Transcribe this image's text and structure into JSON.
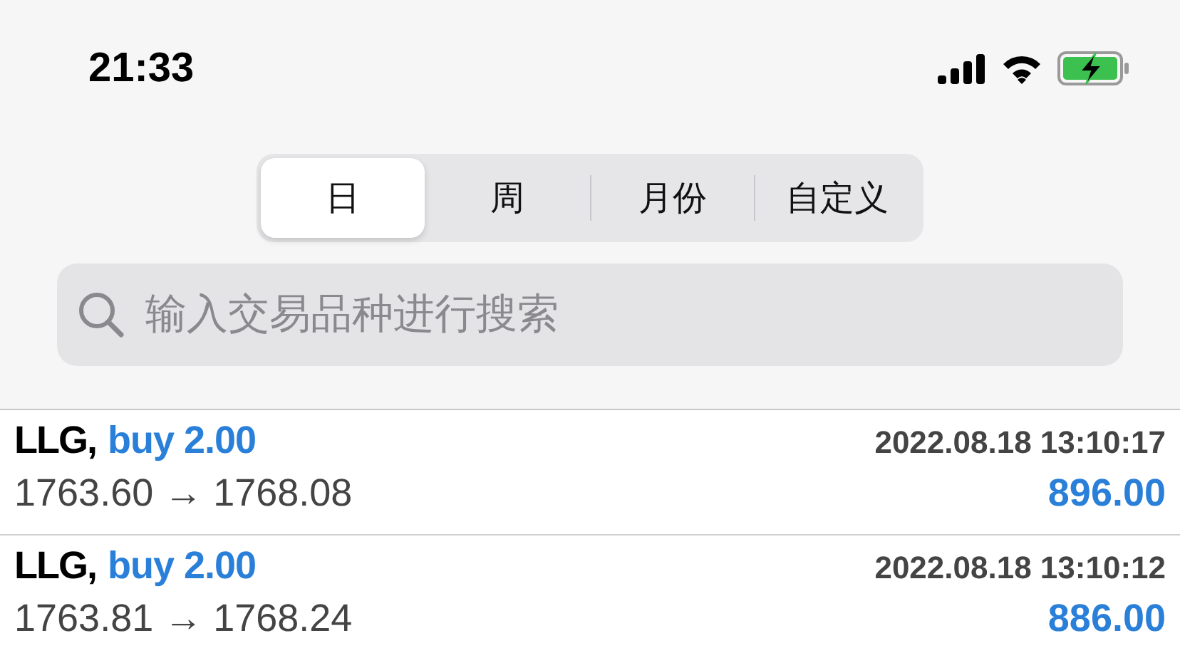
{
  "status_bar": {
    "time": "21:33"
  },
  "period_tabs": [
    {
      "label": "日",
      "selected": true
    },
    {
      "label": "周",
      "selected": false
    },
    {
      "label": "月份",
      "selected": false
    },
    {
      "label": "自定义",
      "selected": false
    }
  ],
  "search": {
    "placeholder": "输入交易品种进行搜索"
  },
  "deals": [
    {
      "symbol": "LLG,",
      "action": "buy 2.00",
      "time": "2022.08.18 13:10:17",
      "prices": "1763.60 → 1768.08",
      "profit": "896.00"
    },
    {
      "symbol": "LLG,",
      "action": "buy 2.00",
      "time": "2022.08.18 13:10:12",
      "prices": "1763.81 → 1768.24",
      "profit": "886.00"
    }
  ]
}
